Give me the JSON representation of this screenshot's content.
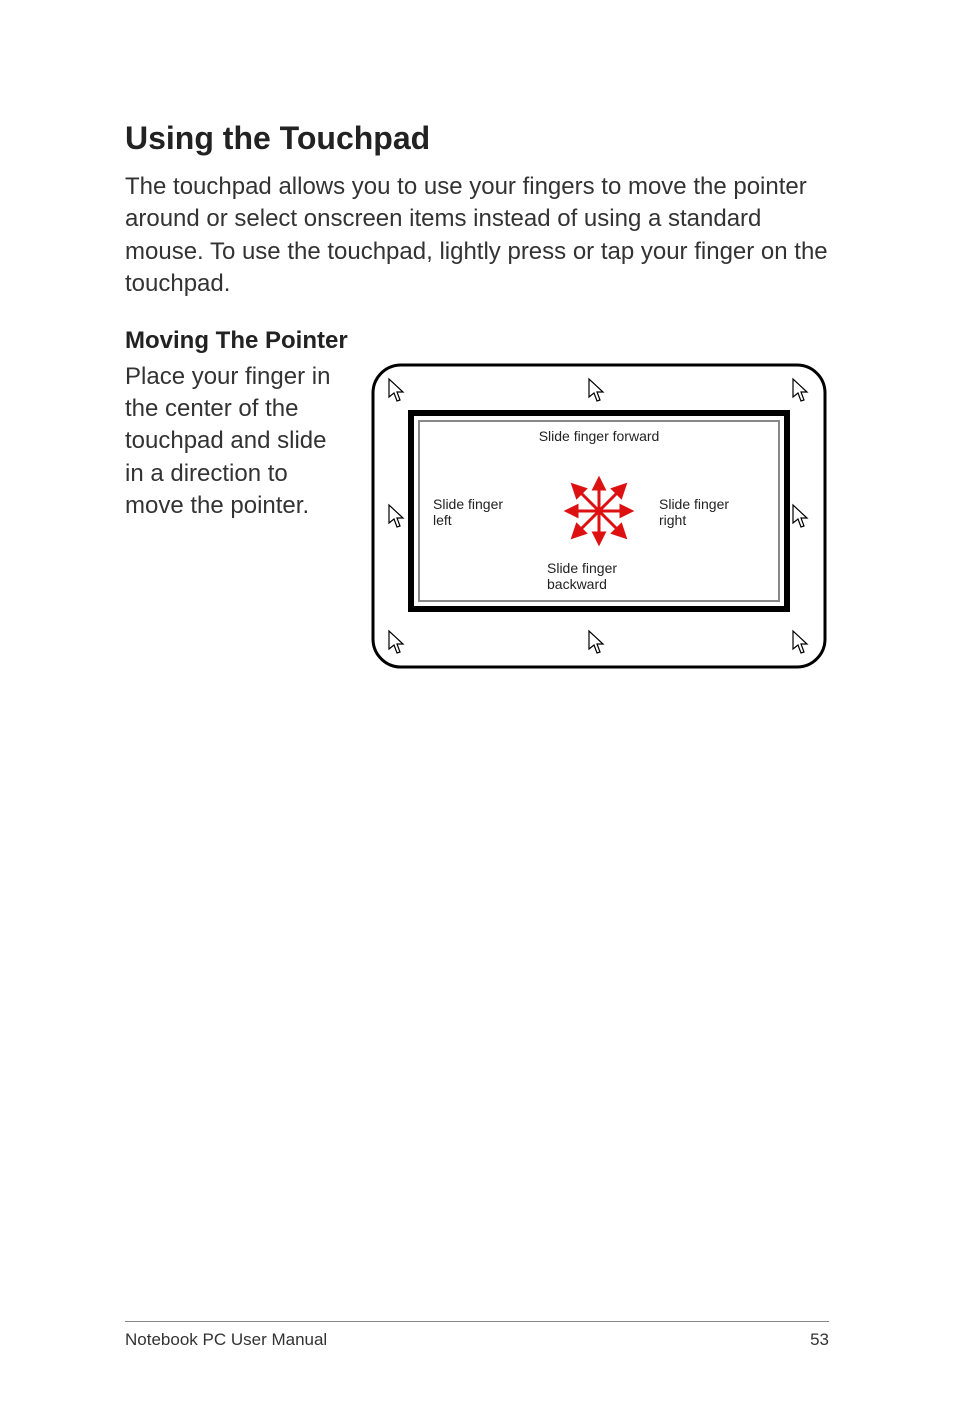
{
  "heading": "Using the Touchpad",
  "intro": "The touchpad allows you to use your fingers to move the pointer around or select onscreen items instead of using a standard mouse. To use the touchpad, lightly press or tap your finger on the touchpad.",
  "subheading": "Moving The Pointer",
  "instruction": "Place your finger in the center of the touchpad and slide in a direction to move the pointer.",
  "diagram": {
    "label_forward": "Slide finger forward",
    "label_left": "Slide finger left",
    "label_right": "Slide finger right",
    "label_backward": "Slide finger backward"
  },
  "footer": {
    "doc_title": "Notebook PC User Manual",
    "page_number": "53"
  }
}
